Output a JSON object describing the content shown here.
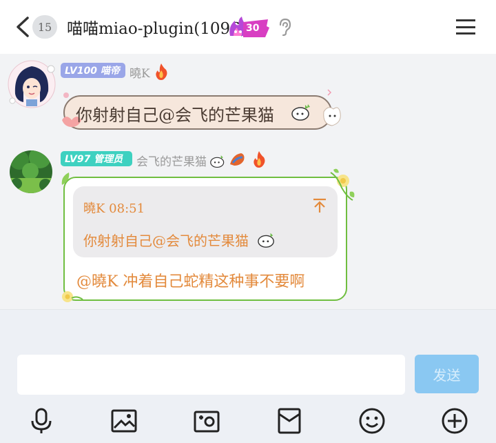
{
  "header": {
    "unread_count": "15",
    "title": "喵喵miao-plugin(1096)",
    "level_badge": "30",
    "menu_icon": "menu-icon",
    "back_icon": "back-icon",
    "ear_icon": "ear-icon"
  },
  "messages": [
    {
      "tag": "LV100 喵帝",
      "tag_color": "#9aa6e8",
      "sender": "曉K",
      "text": "你射射自己@会飞的芒果猫"
    },
    {
      "tag": "LV97 管理员",
      "tag_color": "#3ed1c0",
      "sender": "会飞的芒果猫",
      "quote": {
        "sender_time": "曉K 08:51",
        "text": "你射射自己@会飞的芒果猫"
      },
      "text": "@曉K 冲着自己蛇精这种事不要啊"
    }
  ],
  "composer": {
    "input_value": "",
    "send_label": "发送"
  },
  "toolbar": [
    "microphone-icon",
    "image-icon",
    "camera-icon",
    "red-packet-icon",
    "emoji-icon",
    "add-icon"
  ]
}
